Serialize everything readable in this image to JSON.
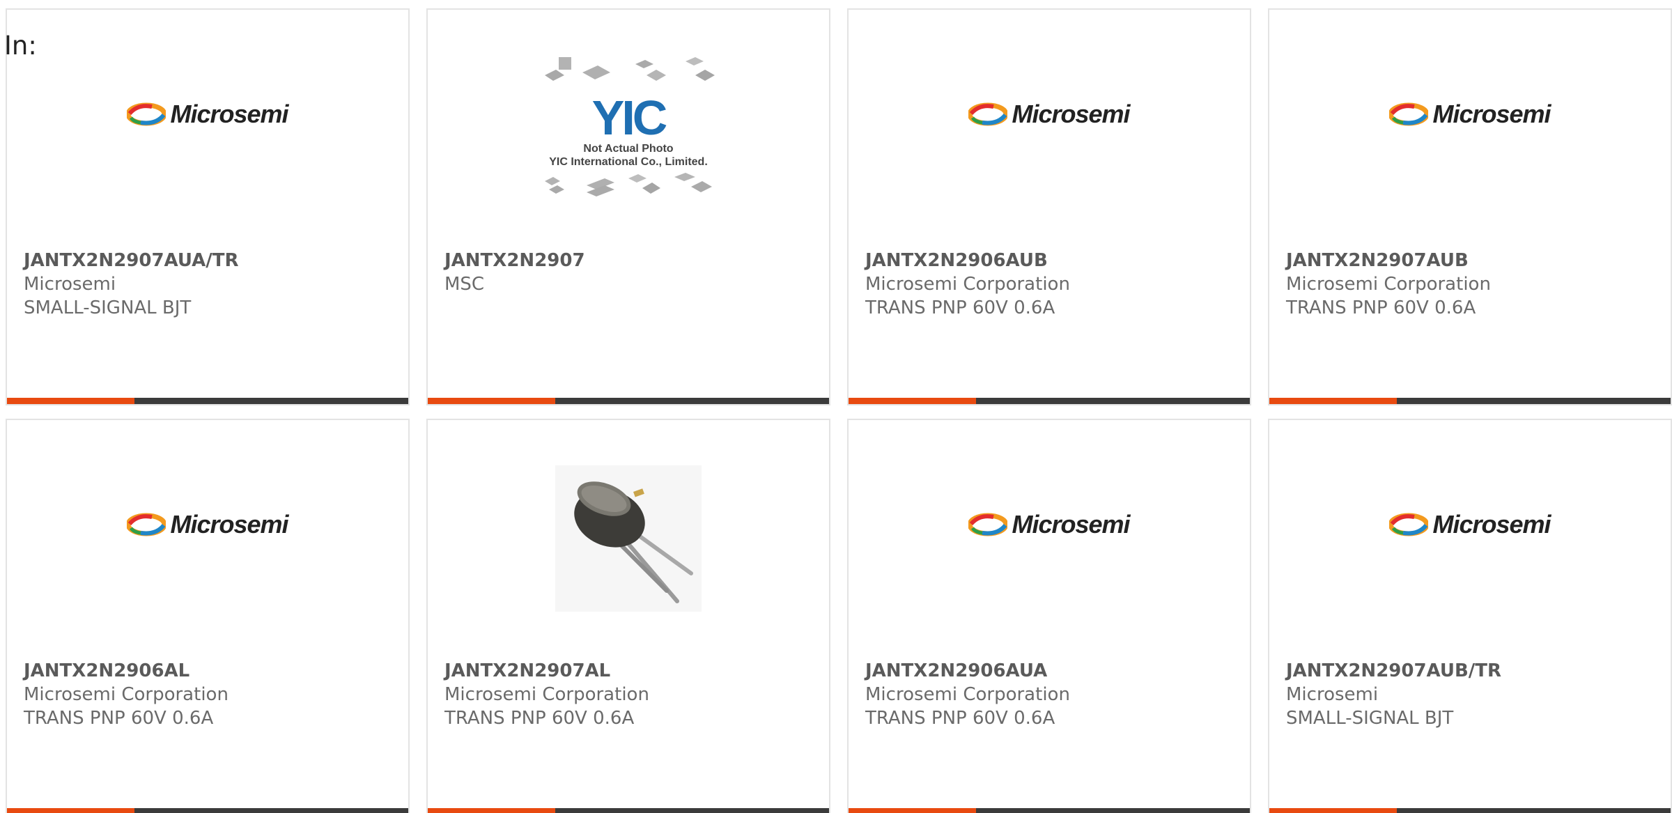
{
  "header": {
    "label": "In:"
  },
  "theme": {
    "accent_color": "#e84a10",
    "bar_dark_color": "#3b3b3b",
    "card_border_color": "#e3e3e3"
  },
  "placeholder": {
    "brand": "YIC",
    "line1": "Not Actual Photo",
    "line2": "YIC International Co., Limited."
  },
  "logo_text": "Microsemi",
  "products": [
    {
      "part_number": "JANTX2N2907AUA/TR",
      "manufacturer": "Microsemi",
      "description": "SMALL-SIGNAL BJT",
      "image": "microsemi-logo"
    },
    {
      "part_number": "JANTX2N2907",
      "manufacturer": "MSC",
      "description": "",
      "image": "not-actual-photo-placeholder"
    },
    {
      "part_number": "JANTX2N2906AUB",
      "manufacturer": "Microsemi Corporation",
      "description": "TRANS PNP 60V 0.6A",
      "image": "microsemi-logo"
    },
    {
      "part_number": "JANTX2N2907AUB",
      "manufacturer": "Microsemi Corporation",
      "description": "TRANS PNP 60V 0.6A",
      "image": "microsemi-logo"
    },
    {
      "part_number": "JANTX2N2906AL",
      "manufacturer": "Microsemi Corporation",
      "description": "TRANS PNP 60V 0.6A",
      "image": "microsemi-logo"
    },
    {
      "part_number": "JANTX2N2907AL",
      "manufacturer": "Microsemi Corporation",
      "description": "TRANS PNP 60V 0.6A",
      "image": "to18-transistor-photo"
    },
    {
      "part_number": "JANTX2N2906AUA",
      "manufacturer": "Microsemi Corporation",
      "description": "TRANS PNP 60V 0.6A",
      "image": "microsemi-logo"
    },
    {
      "part_number": "JANTX2N2907AUB/TR",
      "manufacturer": "Microsemi",
      "description": "SMALL-SIGNAL BJT",
      "image": "microsemi-logo"
    }
  ]
}
